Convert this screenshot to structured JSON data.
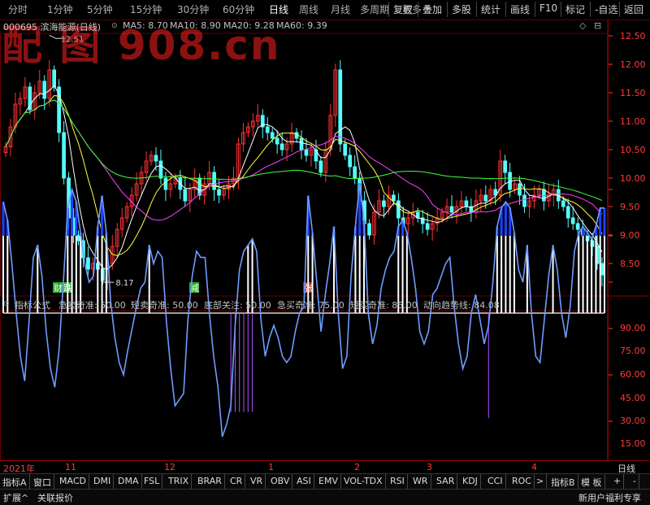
{
  "toolbar": {
    "left": [
      "分时",
      "1分钟",
      "5分钟",
      "15分钟",
      "30分钟",
      "60分钟",
      "日线",
      "周线",
      "月线",
      "多周期",
      "更多"
    ],
    "more_arrow": "▸",
    "active": "日线",
    "right": [
      "复权",
      "叠加",
      "多股",
      "统计",
      "画线",
      "F10",
      "标记",
      "-自选",
      "返回"
    ]
  },
  "watermark": "配 图 908.cn",
  "header": {
    "code_name": "000695 滨海能源(日线)",
    "ma": [
      {
        "label": "MA5: 8.70",
        "color": "#ffffff"
      },
      {
        "label": "MA10: 8.90",
        "color": "#ffff40"
      },
      {
        "label": "MA20: 9.28",
        "color": "#ff40ff"
      },
      {
        "label": "MA60: 9.39",
        "color": "#40ff40"
      }
    ]
  },
  "indicator": {
    "name": "指标公式",
    "items": [
      {
        "label": "急卖奇准: 50.00",
        "color": "#33aaff"
      },
      {
        "label": "短卖奇准: 50.00",
        "color": "#33e0e0"
      },
      {
        "label": "底部关注: 50.00",
        "color": "#3355ff"
      },
      {
        "label": "急买奇准: 75.00",
        "color": "#ffffff"
      },
      {
        "label": "短买奇准: 85.00",
        "color": "#ffffff"
      },
      {
        "label": "动向趋势线: 84.08",
        "color": "#7aa8ff"
      }
    ]
  },
  "markers": {
    "high": "12.51",
    "low": "8.17",
    "labels": [
      "财",
      "跌",
      "减",
      "张"
    ]
  },
  "price_axis": [
    "12.50",
    "12.00",
    "11.50",
    "11.00",
    "10.50",
    "10.00",
    "9.50",
    "9.00",
    "8.50"
  ],
  "ind_axis": [
    "90.00",
    "75.00",
    "60.00",
    "45.00",
    "30.00",
    "15.00"
  ],
  "date_axis": [
    "2021年",
    "11",
    "12",
    "1",
    "2",
    "3",
    "4"
  ],
  "period_label": "日线",
  "tabs": [
    "指标A",
    "窗口",
    "MACD",
    "DMI",
    "DMA",
    "FSL",
    "TRIX",
    "BRAR",
    "CR",
    "VR",
    "OBV",
    "ASI",
    "EMV",
    "VOL-TDX",
    "RSI",
    "WR",
    "SAR",
    "KDJ",
    "CCI",
    "ROC",
    ">",
    "指标B",
    "模 板",
    "+",
    "-"
  ],
  "bottom": {
    "left": [
      "扩展^",
      "关联报价"
    ],
    "right": "新用户福利专享"
  },
  "chart_data": [
    {
      "type": "candlestick",
      "title": "000695 滨海能源(日线)",
      "ylim": [
        8.17,
        12.51
      ],
      "ticks": [
        8.5,
        9.0,
        9.5,
        10.0,
        10.5,
        11.0,
        11.5,
        12.0,
        12.5
      ],
      "close": [
        10.55,
        10.9,
        11.3,
        11.4,
        11.6,
        11.2,
        11.5,
        11.7,
        11.4,
        11.9,
        11.6,
        10.8,
        10.0,
        9.3,
        9.0,
        8.9,
        8.6,
        8.4,
        8.5,
        8.4,
        8.2,
        8.5,
        8.8,
        9.1,
        9.3,
        9.5,
        9.7,
        9.9,
        10.1,
        10.3,
        10.4,
        10.3,
        10.0,
        9.8,
        9.9,
        10.0,
        9.8,
        9.6,
        9.8,
        10.0,
        9.7,
        9.9,
        10.1,
        9.8,
        9.7,
        9.8,
        9.9,
        10.0,
        10.6,
        10.8,
        10.9,
        11.0,
        11.1,
        10.9,
        10.8,
        10.7,
        10.6,
        10.5,
        10.6,
        10.8,
        10.7,
        10.5,
        10.4,
        10.5,
        10.3,
        10.1,
        10.5,
        11.1,
        11.9,
        10.6,
        10.4,
        10.2,
        10.0,
        9.6,
        9.2,
        9.0,
        9.4,
        9.6,
        9.5,
        9.7,
        9.6,
        9.3,
        9.2,
        9.3,
        9.4,
        9.3,
        9.2,
        9.1,
        9.2,
        9.3,
        9.4,
        9.5,
        9.4,
        9.5,
        9.6,
        9.5,
        9.4,
        9.6,
        9.7,
        9.6,
        9.8,
        9.7,
        10.3,
        10.1,
        9.8,
        9.9,
        9.7,
        9.5,
        9.6,
        9.7,
        9.8,
        9.6,
        9.7,
        9.8,
        9.6,
        9.5,
        9.3,
        9.2,
        9.1,
        9.0,
        8.9,
        8.8,
        8.5,
        8.3
      ],
      "markers": {
        "high": 12.51,
        "low": 8.17
      },
      "series": [
        {
          "name": "MA5",
          "color": "#ffffff",
          "last": 8.7
        },
        {
          "name": "MA10",
          "color": "#ffff40",
          "last": 8.9
        },
        {
          "name": "MA20",
          "color": "#ff40ff",
          "last": 9.28
        },
        {
          "name": "MA60",
          "color": "#40ff40",
          "last": 9.39
        }
      ],
      "xlabel": "",
      "ylabel": ""
    },
    {
      "type": "line",
      "title": "指标公式",
      "ylim": [
        8,
        100
      ],
      "ticks": [
        15,
        30,
        45,
        60,
        75,
        90
      ],
      "baseline": 50,
      "values": [
        86,
        80,
        66,
        50,
        36,
        28,
        47,
        68,
        72,
        62,
        44,
        32,
        26,
        38,
        60,
        84,
        90,
        86,
        76,
        66,
        60,
        62,
        78,
        88,
        76,
        54,
        42,
        34,
        30,
        38,
        45,
        52,
        58,
        60,
        72,
        66,
        70,
        68,
        47,
        32,
        20,
        22,
        24,
        48,
        62,
        70,
        68,
        68,
        50,
        36,
        26,
        10,
        14,
        20,
        46,
        64,
        70,
        72,
        74,
        70,
        48,
        36,
        42,
        46,
        42,
        36,
        34,
        36,
        44,
        50,
        52,
        88,
        76,
        60,
        44,
        56,
        66,
        78,
        50,
        32,
        36,
        62,
        78,
        92,
        80,
        50,
        40,
        46,
        58,
        64,
        68,
        70,
        78,
        80,
        76,
        68,
        58,
        44,
        40,
        44,
        56,
        58,
        62,
        66,
        68,
        52,
        40,
        32,
        36,
        50,
        56,
        48,
        40,
        46,
        60,
        78,
        84,
        86,
        84,
        76,
        64,
        60,
        72,
        50,
        36,
        34,
        48,
        62,
        72,
        64,
        50,
        42,
        52,
        70,
        76,
        78,
        76,
        74,
        78,
        84,
        84
      ],
      "buy_fill_upper": 75,
      "sell_fill_upper": 90,
      "bottom_marks": [
        [
          53,
          58,
          18,
          50
        ],
        [
          113,
          113,
          16,
          50
        ]
      ],
      "series": [
        {
          "name": "急卖奇准",
          "last": 50.0
        },
        {
          "name": "短卖奇准",
          "last": 50.0
        },
        {
          "name": "底部关注",
          "last": 50.0
        },
        {
          "name": "急买奇准",
          "last": 75.0
        },
        {
          "name": "短买奇准",
          "last": 85.0
        },
        {
          "name": "动向趋势线",
          "last": 84.08
        }
      ]
    }
  ]
}
